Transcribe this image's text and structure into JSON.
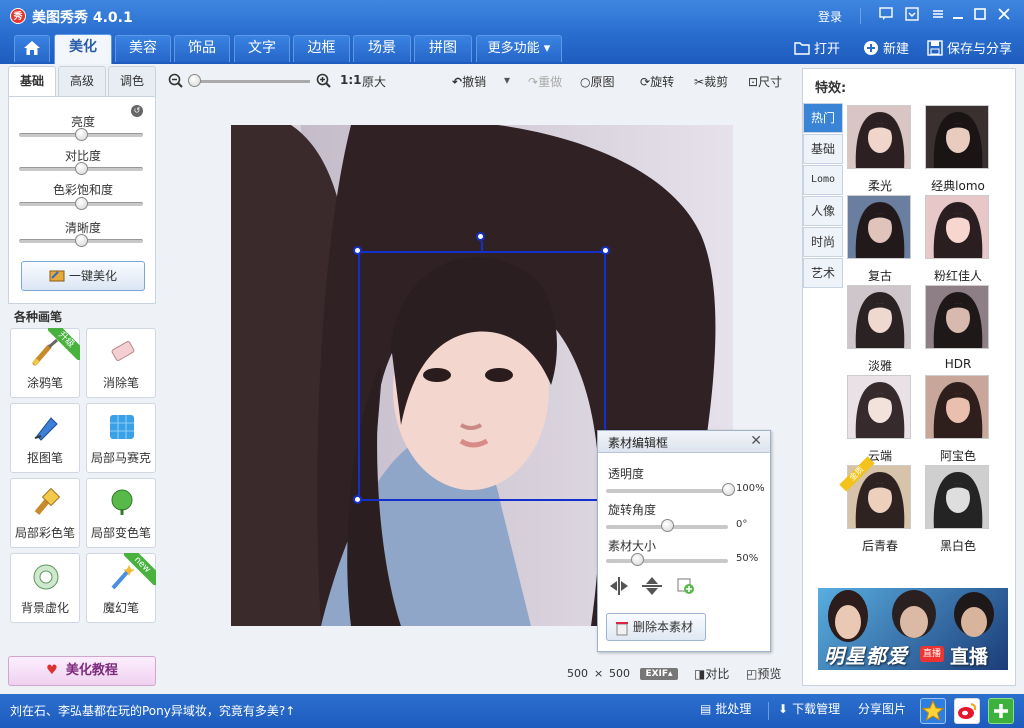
{
  "window": {
    "title": "美图秀秀 4.0.1",
    "logo_text": "秀",
    "login": "登录"
  },
  "nav": {
    "tabs": [
      "美化",
      "美容",
      "饰品",
      "文字",
      "边框",
      "场景",
      "拼图",
      "更多功能 ▾"
    ],
    "active_tab": "美化",
    "open": "打开",
    "new": "新建",
    "save_share": "保存与分享"
  },
  "left": {
    "tabs": [
      "基础",
      "高级",
      "调色"
    ],
    "sliders": [
      {
        "label": "亮度",
        "value": 0.5
      },
      {
        "label": "对比度",
        "value": 0.5
      },
      {
        "label": "色彩饱和度",
        "value": 0.5
      },
      {
        "label": "清晰度",
        "value": 0.5
      }
    ],
    "one_key": "一键美化",
    "brushes_title": "各种画笔",
    "brushes": [
      {
        "label": "涂鸦笔",
        "ribbon": "升级"
      },
      {
        "label": "消除笔",
        "ribbon": ""
      },
      {
        "label": "抠图笔",
        "ribbon": ""
      },
      {
        "label": "局部马赛克",
        "ribbon": ""
      },
      {
        "label": "局部彩色笔",
        "ribbon": ""
      },
      {
        "label": "局部变色笔",
        "ribbon": ""
      },
      {
        "label": "背景虚化",
        "ribbon": ""
      },
      {
        "label": "魔幻笔",
        "ribbon": "new"
      }
    ],
    "tutorial": "美化教程"
  },
  "toolbar": {
    "zoom_ratio": "1:1",
    "original_size": "原大",
    "undo": "撤销",
    "redo": "重做",
    "original": "原图",
    "rotate": "旋转",
    "crop": "裁剪",
    "size": "尺寸"
  },
  "canvas": {
    "width_text": "500",
    "times": "×",
    "height_text": "500",
    "exif": "EXIF▴",
    "compare": "对比",
    "preview": "预览"
  },
  "material": {
    "title": "素材编辑框",
    "opacity_label": "透明度",
    "opacity_value": "100%",
    "opacity_level": 1.0,
    "rotation_label": "旋转角度",
    "rotation_value": "0°",
    "rotation_level": 0.5,
    "size_label": "素材大小",
    "size_value": "50%",
    "size_level": 0.25,
    "delete": "删除本素材"
  },
  "effects": {
    "title": "特效:",
    "categories": [
      "热门",
      "基础",
      "Lomo",
      "人像",
      "时尚",
      "艺术"
    ],
    "active_category": "热门",
    "items": [
      "柔光",
      "经典lomo",
      "复古",
      "粉红佳人",
      "淡雅",
      "HDR",
      "云端",
      "阿宝色",
      "后青春",
      "黑白色"
    ],
    "gold_badge": "金质"
  },
  "ad": {
    "text": "明星都爱",
    "badge": "直播",
    "tail": "直播"
  },
  "status": {
    "message": "刘在石、李弘基都在玩的Pony异域妆，究竟有多美?↑",
    "batch": "批处理",
    "download": "下载管理",
    "share_photo": "分享图片"
  },
  "colors": {
    "title_bar": "#2a6fd0",
    "selection": "#1330cc",
    "active_effect_tab": "#3a84d6"
  }
}
